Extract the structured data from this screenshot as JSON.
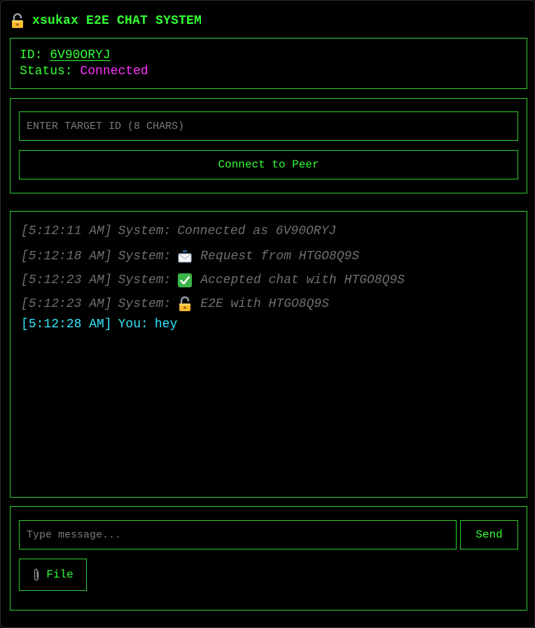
{
  "app": {
    "title": "xsukax E2E CHAT SYSTEM",
    "title_icon": "lock-icon"
  },
  "identity": {
    "id_label": "ID:",
    "id_value": "6V90ORYJ",
    "status_label": "Status:",
    "status_value": "Connected",
    "status_color": "#ff33ff"
  },
  "connect": {
    "target_placeholder": "ENTER TARGET ID (8 CHARS)",
    "target_value": "",
    "connect_label": "Connect to Peer"
  },
  "log": [
    {
      "kind": "system",
      "time": "[5:12:11 AM]",
      "sender": "System:",
      "icon": "",
      "text": "Connected as 6V90ORYJ"
    },
    {
      "kind": "system",
      "time": "[5:12:18 AM]",
      "sender": "System:",
      "icon": "envelope-icon",
      "text": "Request from HTGO8Q9S"
    },
    {
      "kind": "system",
      "time": "[5:12:23 AM]",
      "sender": "System:",
      "icon": "check-icon",
      "text": "Accepted chat with HTGO8Q9S"
    },
    {
      "kind": "system",
      "time": "[5:12:23 AM]",
      "sender": "System:",
      "icon": "lock-icon",
      "text": "E2E with HTGO8Q9S"
    },
    {
      "kind": "mine",
      "time": "[5:12:28 AM]",
      "sender": "You:",
      "icon": "",
      "text": "hey"
    }
  ],
  "compose": {
    "message_placeholder": "Type message...",
    "message_value": "",
    "send_label": "Send",
    "file_label": "File",
    "file_icon": "paperclip-icon"
  },
  "colors": {
    "accent": "#33ff33",
    "border": "#2fd12f",
    "system_text": "#6e6e6e",
    "own_message": "#33e6ff",
    "background": "#000000"
  }
}
